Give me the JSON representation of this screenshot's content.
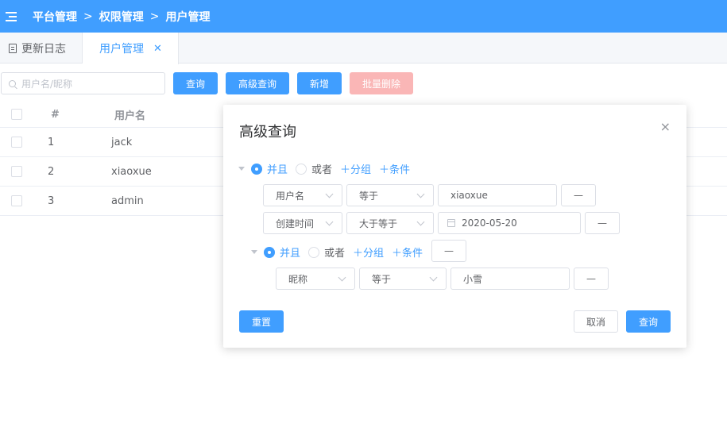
{
  "header": {
    "breadcrumb": [
      "平台管理",
      "权限管理",
      "用户管理"
    ],
    "separator": ">"
  },
  "tabs": [
    {
      "label": "更新日志",
      "icon": "document-icon",
      "active": false
    },
    {
      "label": "用户管理",
      "active": true,
      "closable": true
    }
  ],
  "toolbar": {
    "search_placeholder": "用户名/昵称",
    "query_label": "查询",
    "advanced_label": "高级查询",
    "add_label": "新增",
    "batch_delete_label": "批量删除"
  },
  "table": {
    "columns": [
      "#",
      "用户名"
    ],
    "rows": [
      {
        "index": "1",
        "username": "jack"
      },
      {
        "index": "2",
        "username": "xiaoxue"
      },
      {
        "index": "3",
        "username": "admin"
      }
    ]
  },
  "dialog": {
    "title": "高级查询",
    "close_glyph": "×",
    "group1": {
      "and_label": "并且",
      "or_label": "或者",
      "add_group": "＋分组",
      "add_condition": "＋条件",
      "selected": "and"
    },
    "conditions": [
      {
        "field": "用户名",
        "operator": "等于",
        "value": "xiaoxue",
        "remove": "—"
      },
      {
        "field": "创建时间",
        "operator": "大于等于",
        "value": "2020-05-20",
        "remove": "—"
      }
    ],
    "group2": {
      "and_label": "并且",
      "or_label": "或者",
      "add_group": "＋分组",
      "add_condition": "＋条件",
      "remove": "—",
      "selected": "and",
      "conditions": [
        {
          "field": "昵称",
          "operator": "等于",
          "value": "小雪",
          "remove": "—"
        }
      ]
    },
    "reset_label": "重置",
    "cancel_label": "取消",
    "query_label": "查询"
  },
  "colors": {
    "primary": "#409eff",
    "danger_disabled": "#fab6b6"
  }
}
